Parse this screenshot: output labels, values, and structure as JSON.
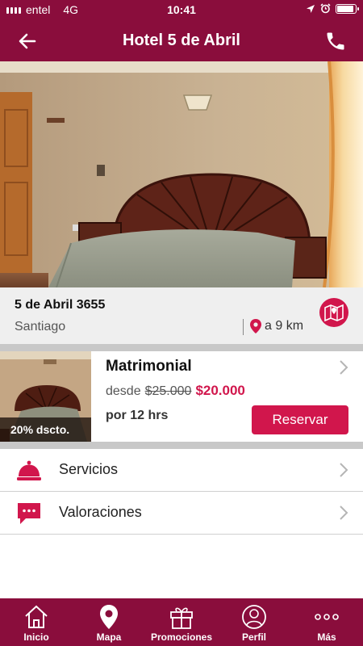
{
  "status_bar": {
    "carrier": "entel",
    "network": "4G",
    "time": "10:41",
    "battery_level": 0.9
  },
  "header": {
    "title": "Hotel 5 de Abril",
    "back_icon": "back-arrow-icon",
    "call_icon": "phone-icon"
  },
  "hotel": {
    "address": "5 de Abril 3655",
    "city": "Santiago",
    "distance": "a 9 km"
  },
  "room": {
    "name": "Matrimonial",
    "from_label": "desde",
    "old_price": "$25.000",
    "new_price": "$20.000",
    "duration": "por 12 hrs",
    "discount": "20% dscto.",
    "reserve_label": "Reservar"
  },
  "menu": {
    "items": [
      {
        "label": "Servicios",
        "icon": "bell-icon"
      },
      {
        "label": "Valoraciones",
        "icon": "chat-bubble-icon"
      }
    ]
  },
  "tabbar": {
    "items": [
      {
        "label": "Inicio",
        "icon": "home-icon"
      },
      {
        "label": "Mapa",
        "icon": "map-pin-icon"
      },
      {
        "label": "Promociones",
        "icon": "gift-icon"
      },
      {
        "label": "Perfil",
        "icon": "user-icon"
      },
      {
        "label": "Más",
        "icon": "more-icon"
      }
    ]
  },
  "colors": {
    "brand": "#8a0d3c",
    "accent": "#d1164c",
    "strip": "#efefef"
  }
}
